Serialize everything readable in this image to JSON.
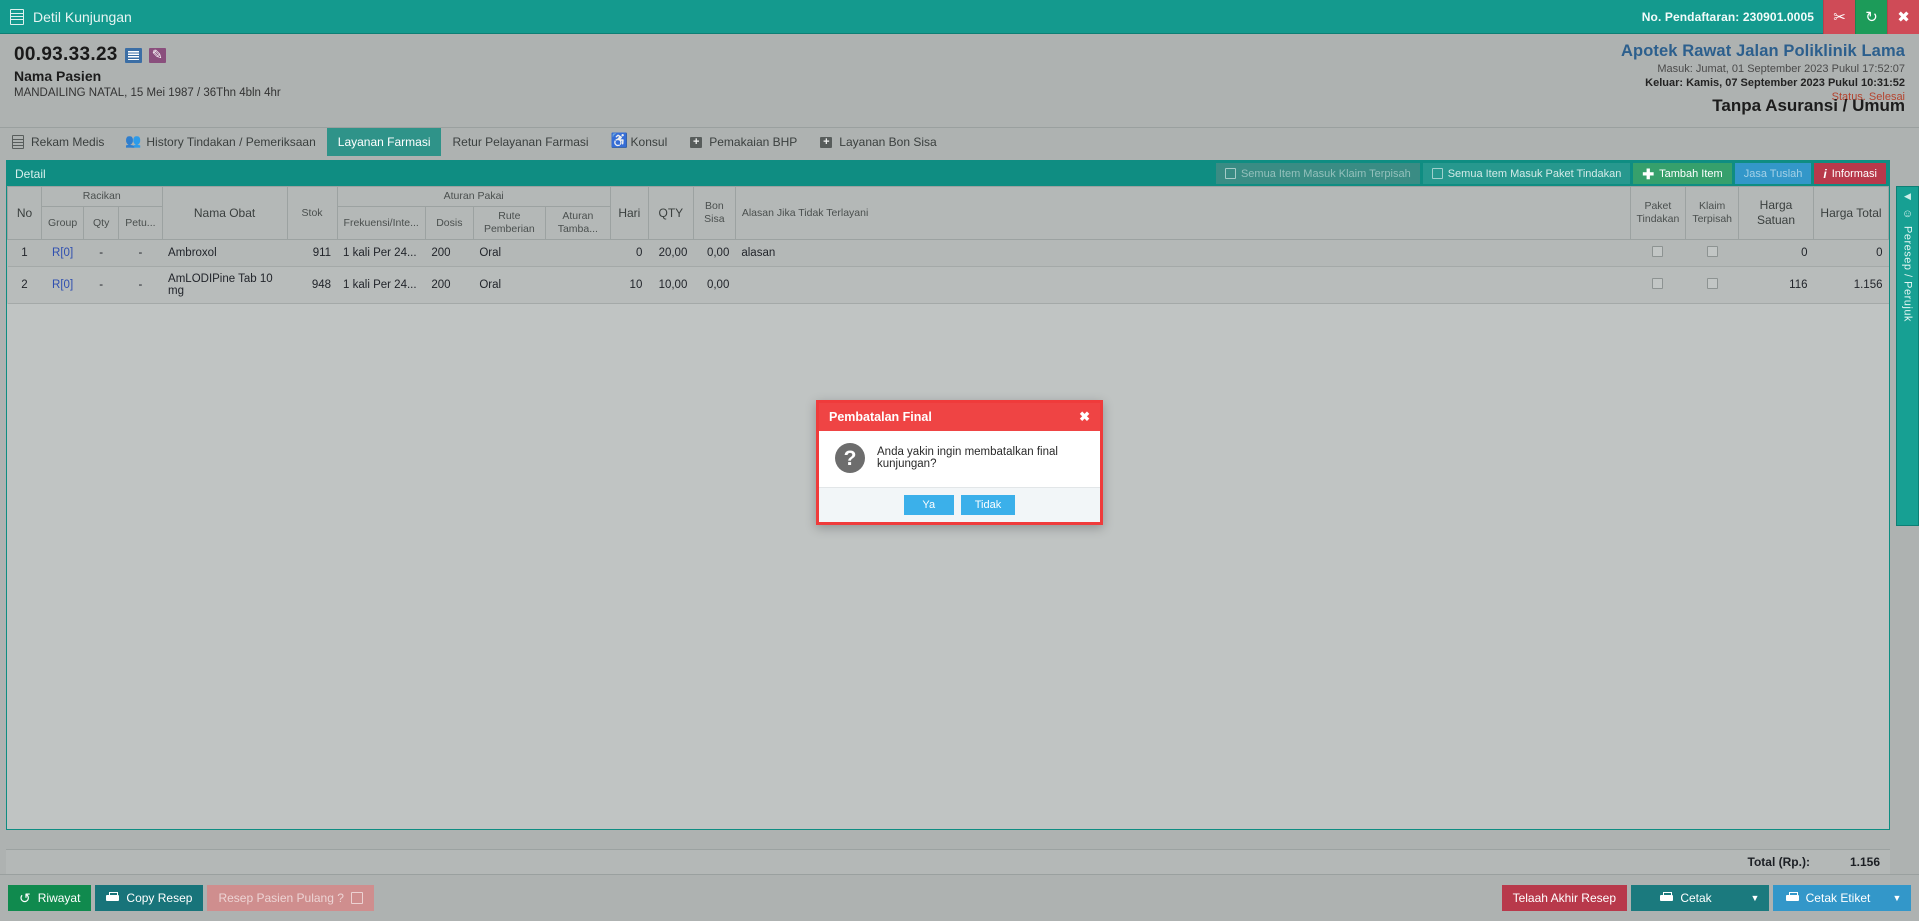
{
  "titlebar": {
    "title": "Detil Kunjungan",
    "doc_icon": "document-icon",
    "registration_label": "No. Pendaftaran: 230901.0005",
    "btn_scissors": "✂",
    "btn_refresh": "↻",
    "btn_close": "✖"
  },
  "patient": {
    "mrn": "00.93.33.23",
    "name": "Nama Pasien",
    "meta": "MANDAILING NATAL, 15 Mei 1987 / 36Thn 4bln 4hr"
  },
  "visit": {
    "unit": "Apotek Rawat Jalan Poliklinik Lama",
    "masuk": "Masuk: Jumat, 01 September 2023 Pukul 17:52:07",
    "keluar": "Keluar: Kamis, 07 September 2023 Pukul 10:31:52",
    "status": "Status. Selesai",
    "insurance": "Tanpa Asuransi / Umum"
  },
  "tabs": [
    {
      "label": "Rekam Medis",
      "icon": "document-icon",
      "active": false
    },
    {
      "label": "History Tindakan / Pemeriksaan",
      "icon": "people-icon",
      "active": false
    },
    {
      "label": "Layanan Farmasi",
      "icon": "none",
      "active": true
    },
    {
      "label": "Retur Pelayanan Farmasi",
      "icon": "none",
      "active": false
    },
    {
      "label": "Konsul",
      "icon": "wheelchair-icon",
      "active": false
    },
    {
      "label": "Pemakaian BHP",
      "icon": "medkit-icon",
      "active": false
    },
    {
      "label": "Layanan Bon Sisa",
      "icon": "medkit-icon",
      "active": false
    }
  ],
  "panel": {
    "title": "Detail",
    "actions": {
      "semua_klaim_terpisah": "Semua Item Masuk Klaim Terpisah",
      "semua_paket_tindakan": "Semua Item Masuk Paket Tindakan",
      "tambah_item": "Tambah Item",
      "jasa_tuslah": "Jasa Tuslah",
      "informasi": "Informasi"
    }
  },
  "table": {
    "headers": {
      "no": "No",
      "racikan": "Racikan",
      "group": "Group",
      "qty_racikan": "Qty",
      "petu": "Petu...",
      "nama_obat": "Nama Obat",
      "stok": "Stok",
      "aturan_pakai": "Aturan Pakai",
      "frekuensi": "Frekuensi/Inte...",
      "dosis": "Dosis",
      "rute": "Rute Pemberian",
      "aturan_tambahan": "Aturan Tamba...",
      "hari": "Hari",
      "qty": "QTY",
      "bon_sisa": "Bon Sisa",
      "alasan": "Alasan Jika Tidak Terlayani",
      "paket_tindakan": "Paket Tindakan",
      "klaim_terpisah": "Klaim Terpisah",
      "harga_satuan": "Harga Satuan",
      "harga_total": "Harga Total"
    },
    "rows": [
      {
        "no": "1",
        "group": "R[0]",
        "qty_racikan": "-",
        "petu": "-",
        "nama_obat": "Ambroxol",
        "stok": "911",
        "frekuensi": "1 kali Per 24...",
        "dosis": "200",
        "rute": "Oral",
        "aturan_tambahan": "",
        "hari": "0",
        "qty": "20,00",
        "bon_sisa": "0,00",
        "alasan": "alasan",
        "harga_satuan": "0",
        "harga_total": "0"
      },
      {
        "no": "2",
        "group": "R[0]",
        "qty_racikan": "-",
        "petu": "-",
        "nama_obat": "AmLODIPine Tab 10 mg",
        "stok": "948",
        "frekuensi": "1 kali Per 24...",
        "dosis": "200",
        "rute": "Oral",
        "aturan_tambahan": "",
        "hari": "10",
        "qty": "10,00",
        "bon_sisa": "0,00",
        "alasan": "",
        "harga_satuan": "116",
        "harga_total": "1.156"
      }
    ],
    "total_label": "Total (Rp.):",
    "total_value": "1.156"
  },
  "side_tab": {
    "label": "Peresep / Perujuk",
    "collapse_icon": "caret-left-icon",
    "doctor_icon": "doctor-icon"
  },
  "footer": {
    "riwayat": "Riwayat",
    "copy_resep": "Copy Resep",
    "resep_pasien_pulang": "Resep Pasien Pulang ?",
    "telaah_akhir_resep": "Telaah Akhir Resep",
    "cetak": "Cetak",
    "cetak_etiket": "Cetak Etiket"
  },
  "modal": {
    "title": "Pembatalan Final",
    "close_icon": "close-icon",
    "question_icon": "question-mark-icon",
    "message": "Anda yakin ingin membatalkan final kunjungan?",
    "yes": "Ya",
    "no": "Tidak"
  },
  "colors": {
    "teal": "#149a8e",
    "panel_teal": "#0f8d82",
    "modal_red": "#ef4444",
    "link_blue": "#2f4fb0",
    "status_red": "#b5442f"
  }
}
